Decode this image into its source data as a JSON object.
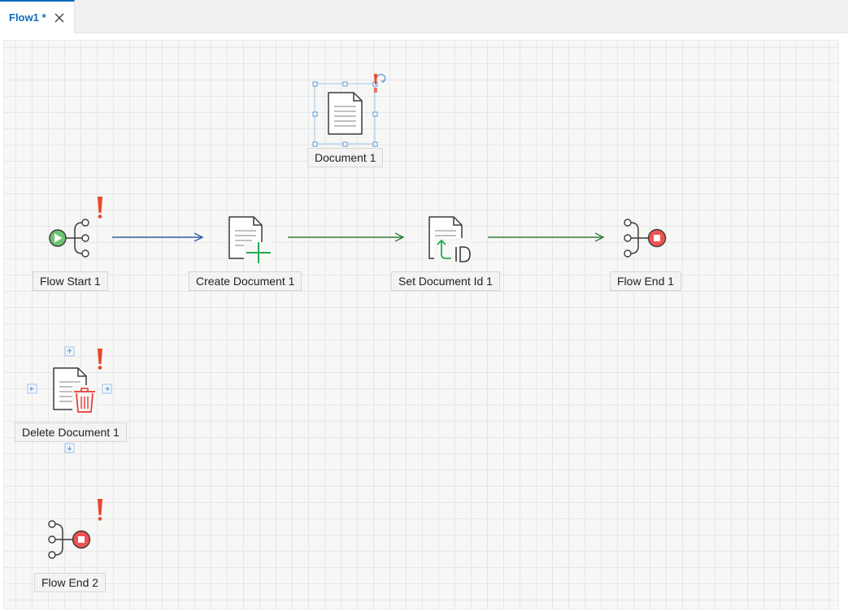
{
  "tab": {
    "title": "Flow1 *",
    "close_icon": "close-icon",
    "accent_color": "#0f6cbd"
  },
  "canvas": {
    "grid": true,
    "background": "#f7f7f6"
  },
  "nodes": {
    "document_1": {
      "label": "Document 1",
      "icon": "document-icon",
      "selected": true,
      "warning": true
    },
    "flow_start_1": {
      "label": "Flow Start 1",
      "icon": "flow-start-icon",
      "warning": true
    },
    "create_document_1": {
      "label": "Create Document 1",
      "icon": "create-document-icon",
      "warning": false
    },
    "set_document_id_1": {
      "label": "Set Document Id 1",
      "icon": "set-document-id-icon",
      "warning": false
    },
    "flow_end_1": {
      "label": "Flow End 1",
      "icon": "flow-end-icon",
      "warning": false
    },
    "delete_document_1": {
      "label": "Delete Document 1",
      "icon": "delete-document-icon",
      "warning": true,
      "hovered": true
    },
    "flow_end_2": {
      "label": "Flow End 2",
      "icon": "flow-end-icon",
      "warning": true
    }
  },
  "connections": [
    {
      "from": "Flow Start 1",
      "to": "Create Document 1",
      "color": "#2e5f9e"
    },
    {
      "from": "Create Document 1",
      "to": "Set Document Id 1",
      "color": "#2f7d3a"
    },
    {
      "from": "Set Document Id 1",
      "to": "Flow End 1",
      "color": "#2f7d3a"
    }
  ],
  "colors": {
    "warning": "#e8462b",
    "start": "#4caf50",
    "end": "#e53935",
    "add": "#22a94f",
    "delete": "#e53935",
    "selection": "#9fc3ea"
  }
}
